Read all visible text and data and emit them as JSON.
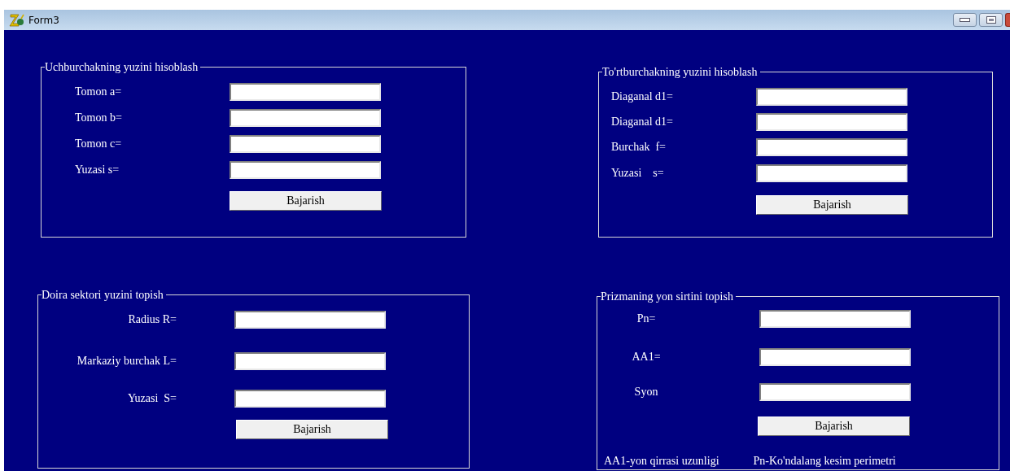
{
  "window": {
    "title": "Form3"
  },
  "groups": [
    {
      "title": "Uchburchakning yuzini hisoblash",
      "fields": [
        {
          "label": "Tomon a="
        },
        {
          "label": "Tomon b="
        },
        {
          "label": "Tomon c="
        },
        {
          "label": "Yuzasi s="
        }
      ],
      "button": "Bajarish"
    },
    {
      "title": "To'rtburchakning yuzini hisoblash",
      "fields": [
        {
          "label": "Diaganal d1="
        },
        {
          "label": "Diaganal d1="
        },
        {
          "label": "Burchak  f="
        },
        {
          "label": "Yuzasi    s="
        }
      ],
      "button": "Bajarish"
    },
    {
      "title": "Doira sektori yuzini topish",
      "fields": [
        {
          "label": "Radius R="
        },
        {
          "label": "Markaziy burchak L="
        },
        {
          "label": "Yuzasi  S="
        }
      ],
      "button": "Bajarish"
    },
    {
      "title": "Prizmaning yon sirtini topish",
      "fields": [
        {
          "label": "Pn="
        },
        {
          "label": "AA1="
        },
        {
          "label": "Syon"
        }
      ],
      "button": "Bajarish",
      "notes": [
        "AA1-yon qirrasi uzunligi",
        "Pn-Ko'ndalang kesim perimetri"
      ]
    }
  ]
}
